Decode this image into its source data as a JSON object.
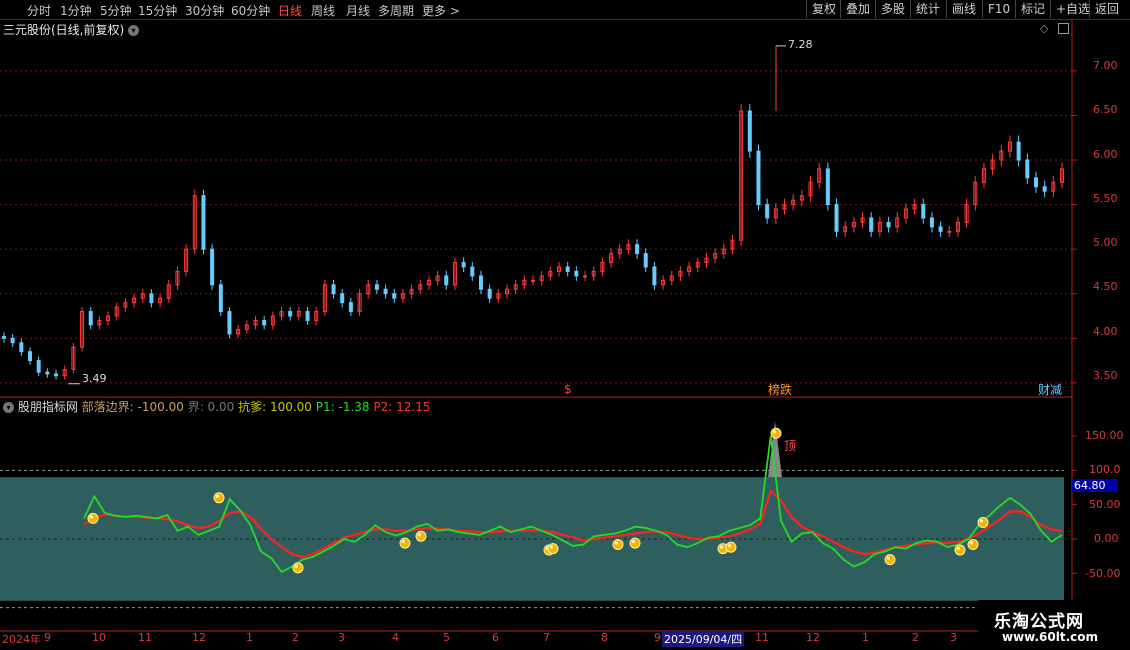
{
  "toolbar": {
    "periods": [
      "分时",
      "1分钟",
      "5分钟",
      "15分钟",
      "30分钟",
      "60分钟",
      "日线",
      "周线",
      "月线",
      "多周期",
      "更多 >"
    ],
    "active_period": "日线",
    "right_buttons": [
      "复权",
      "叠加",
      "多股",
      "统计",
      "画线",
      "F10",
      "标记",
      "+自选",
      "返回"
    ]
  },
  "main_chart": {
    "title": "三元股份(日线,前复权)",
    "high_label": "7.28",
    "low_label": "3.49",
    "price_ticks": [
      "7.00",
      "6.50",
      "6.00",
      "5.50",
      "5.00",
      "4.50",
      "4.00",
      "3.50"
    ],
    "markers": [
      {
        "text": "$",
        "color": "#ff3b3b"
      },
      {
        "text": "榜跌",
        "color": "#ff9933"
      },
      {
        "text": "财减",
        "color": "#66ccff"
      }
    ]
  },
  "indicator": {
    "name": "股朋指标网",
    "params": [
      {
        "text": "部落边界: -100.00",
        "color": "#c8a060"
      },
      {
        "text": "界: 0.00",
        "color": "#777777"
      },
      {
        "text": "抗爹: 100.00",
        "color": "#c8c800"
      },
      {
        "text": "P1: -1.38",
        "color": "#22dd22"
      },
      {
        "text": "P2: 12.15",
        "color": "#ff3333"
      }
    ],
    "ticks": [
      "150.00",
      "100.0",
      "50.00",
      "0.00",
      "-50.00"
    ],
    "current_value": "64.80",
    "top_label": "顶"
  },
  "x_axis": [
    "2024年",
    "9",
    "10",
    "11",
    "12",
    "1",
    "2",
    "3",
    "4",
    "5",
    "6",
    "7",
    "8",
    "9",
    "2025/09/04/四",
    "11",
    "12",
    "1",
    "2",
    "3"
  ],
  "watermark": {
    "name": "乐淘公式网",
    "url": "www.60lt.com"
  },
  "colors": {
    "bg": "#000000",
    "up": "#ff3b3b",
    "down": "#66ccff",
    "p1": "#22dd22",
    "p2": "#ff2222",
    "band": "#2f5e5e",
    "grid": "#7a1a1a"
  },
  "chart_data": {
    "type": "candlestick",
    "price_range": [
      3.3,
      7.6
    ],
    "indicator_range": [
      -100,
      190
    ],
    "price_closes": [
      4.0,
      3.95,
      3.85,
      3.75,
      3.62,
      3.6,
      3.58,
      3.65,
      3.9,
      4.3,
      4.15,
      4.2,
      4.25,
      4.35,
      4.4,
      4.45,
      4.5,
      4.4,
      4.45,
      4.6,
      4.75,
      5.0,
      5.6,
      5.0,
      4.6,
      4.3,
      4.05,
      4.1,
      4.15,
      4.2,
      4.15,
      4.25,
      4.3,
      4.25,
      4.3,
      4.2,
      4.3,
      4.6,
      4.5,
      4.4,
      4.3,
      4.5,
      4.6,
      4.55,
      4.5,
      4.45,
      4.5,
      4.55,
      4.6,
      4.65,
      4.7,
      4.6,
      4.85,
      4.8,
      4.7,
      4.55,
      4.45,
      4.5,
      4.55,
      4.6,
      4.65,
      4.65,
      4.7,
      4.75,
      4.8,
      4.75,
      4.7,
      4.7,
      4.75,
      4.85,
      4.95,
      5.0,
      5.05,
      4.95,
      4.8,
      4.6,
      4.65,
      4.7,
      4.75,
      4.8,
      4.85,
      4.9,
      4.95,
      5.0,
      5.1,
      6.55,
      6.1,
      5.5,
      5.35,
      5.45,
      5.5,
      5.55,
      5.6,
      5.75,
      5.9,
      5.5,
      5.2,
      5.25,
      5.3,
      5.35,
      5.2,
      5.3,
      5.25,
      5.35,
      5.45,
      5.5,
      5.35,
      5.25,
      5.2,
      5.2,
      5.3,
      5.5,
      5.75,
      5.9,
      6.0,
      6.1,
      6.2,
      6.0,
      5.8,
      5.7,
      5.65,
      5.75,
      5.9
    ],
    "osc_p1": [
      30,
      62,
      38,
      34,
      32,
      34,
      32,
      30,
      35,
      12,
      18,
      6,
      12,
      18,
      58,
      42,
      20,
      -18,
      -28,
      -48,
      -40,
      -30,
      -26,
      -18,
      -10,
      0,
      -4,
      6,
      20,
      10,
      5,
      10,
      18,
      22,
      12,
      14,
      10,
      8,
      6,
      12,
      18,
      10,
      14,
      18,
      12,
      6,
      -2,
      -10,
      -8,
      4,
      6,
      8,
      12,
      18,
      16,
      12,
      6,
      -8,
      -12,
      -6,
      2,
      4,
      12,
      16,
      20,
      30,
      150,
      26,
      -4,
      8,
      10,
      -6,
      -14,
      -30,
      -40,
      -34,
      -22,
      -18,
      -12,
      -14,
      -6,
      -2,
      -4,
      -12,
      -8,
      0,
      20,
      34,
      48,
      60,
      50,
      36,
      12,
      -4,
      6
    ],
    "osc_p2": [
      22,
      30,
      36,
      34,
      33,
      32,
      31,
      30,
      29,
      26,
      20,
      16,
      18,
      26,
      38,
      40,
      32,
      15,
      0,
      -12,
      -22,
      -26,
      -22,
      -14,
      -6,
      2,
      6,
      10,
      14,
      14,
      12,
      12,
      14,
      16,
      15,
      14,
      12,
      11,
      10,
      10,
      11,
      12,
      12,
      13,
      12,
      10,
      6,
      2,
      -2,
      0,
      2,
      4,
      6,
      8,
      10,
      11,
      10,
      6,
      2,
      0,
      0,
      2,
      4,
      8,
      14,
      22,
      70,
      56,
      32,
      18,
      10,
      4,
      -4,
      -12,
      -18,
      -22,
      -20,
      -16,
      -12,
      -10,
      -8,
      -6,
      -5,
      -6,
      -4,
      0,
      8,
      18,
      28,
      40,
      40,
      32,
      20,
      14,
      12
    ]
  }
}
